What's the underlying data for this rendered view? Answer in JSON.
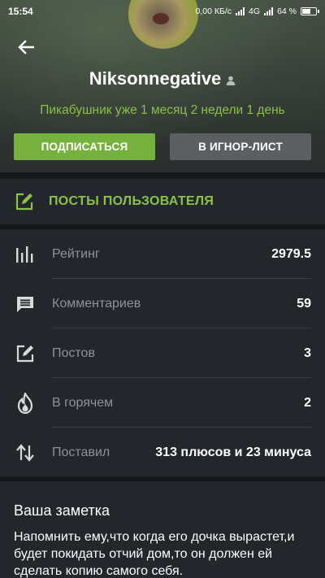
{
  "status_bar": {
    "time": "15:54",
    "network_speed": "0,00 КБ/с",
    "network_type": "4G",
    "battery": "64 %"
  },
  "profile": {
    "username": "Niksonnegative",
    "tenure": "Пикабушник уже 1 месяц 2 недели 1 день",
    "subscribe_label": "ПОДПИСАТЬСЯ",
    "ignore_label": "В ИГНОР-ЛИСТ"
  },
  "posts_link": {
    "label": "ПОСТЫ ПОЛЬЗОВАТЕЛЯ",
    "icon": "edit-icon"
  },
  "stats": [
    {
      "icon": "bar-chart-icon",
      "name": "Рейтинг",
      "value": "2979.5"
    },
    {
      "icon": "comment-icon",
      "name": "Комментариев",
      "value": "59"
    },
    {
      "icon": "edit-icon",
      "name": "Постов",
      "value": "3"
    },
    {
      "icon": "fire-icon",
      "name": "В горячем",
      "value": "2"
    },
    {
      "icon": "sort-arrows-icon",
      "name": "Поставил",
      "value": "313 плюсов и 23 минуса"
    }
  ],
  "note": {
    "title": "Ваша заметка",
    "text": "Напомнить ему,что когда его дочка вырастет,и будет покидать отчий дом,то он должен ей сделать копию самого себя."
  },
  "colors": {
    "accent_green": "#8ac149",
    "button_green": "#77b13d",
    "button_gray": "#5b5f62",
    "card_bg": "#23272b",
    "page_bg": "#1c1f23"
  }
}
